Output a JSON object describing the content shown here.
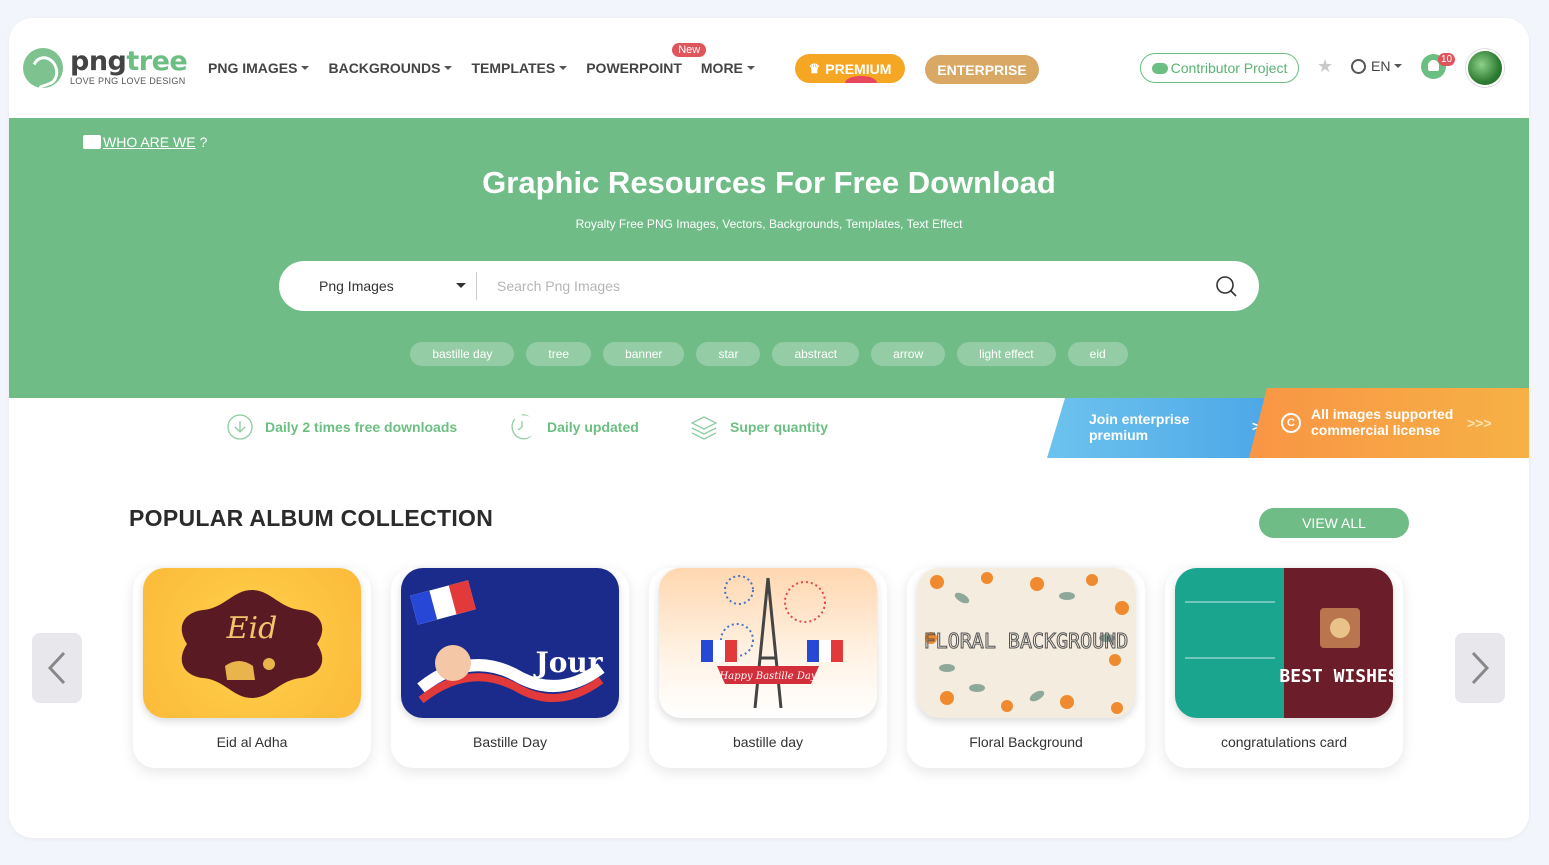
{
  "header": {
    "logo": {
      "name_a": "png",
      "name_b": "tree",
      "tagline": "LOVE PNG LOVE DESIGN"
    },
    "nav": [
      {
        "label": "PNG IMAGES",
        "dropdown": true
      },
      {
        "label": "BACKGROUNDS",
        "dropdown": true
      },
      {
        "label": "TEMPLATES",
        "dropdown": true
      },
      {
        "label": "POWERPOINT",
        "dropdown": false
      },
      {
        "label": "MORE",
        "dropdown": true
      }
    ],
    "new_badge": "New",
    "premium_label": "PREMIUM",
    "enterprise_label": "ENTERPRISE",
    "contributor_label": "Contributor Project",
    "language": "EN",
    "notification_count": "10"
  },
  "hero": {
    "who_label": "WHO ARE WE",
    "who_suffix": "?",
    "title": "Graphic Resources For Free Download",
    "subtitle": "Royalty Free PNG Images, Vectors, Backgrounds, Templates, Text Effect",
    "search": {
      "category": "Png Images",
      "placeholder": "Search Png Images",
      "value": ""
    },
    "tags": [
      "bastille day",
      "tree",
      "banner",
      "star",
      "abstract",
      "arrow",
      "light effect",
      "eid"
    ]
  },
  "features": {
    "items": [
      "Daily 2 times free downloads",
      "Daily updated",
      "Super quantity"
    ],
    "promo_enterprise": {
      "line1": "Join enterprise",
      "line2": "premium",
      "arrows": ">>"
    },
    "promo_license": {
      "line1": "All images supported",
      "line2": "commercial license",
      "arrows": ">>>"
    }
  },
  "albums": {
    "title": "POPULAR ALBUM COLLECTION",
    "view_all": "VIEW ALL",
    "cards": [
      {
        "label": "Eid al Adha",
        "art_text": "Eid"
      },
      {
        "label": "Bastille Day",
        "art_text": "Jour"
      },
      {
        "label": "bastille day",
        "art_text": "Happy Bastille Day"
      },
      {
        "label": "Floral Background",
        "art_text": "FLORAL BACKGROUND"
      },
      {
        "label": "congratulations card",
        "art_text": "BEST WISHES"
      }
    ]
  },
  "colors": {
    "brand_green": "#70bc87",
    "premium": "#f5a623",
    "enterprise": "#d8a864",
    "badge_red": "#e0545c"
  }
}
